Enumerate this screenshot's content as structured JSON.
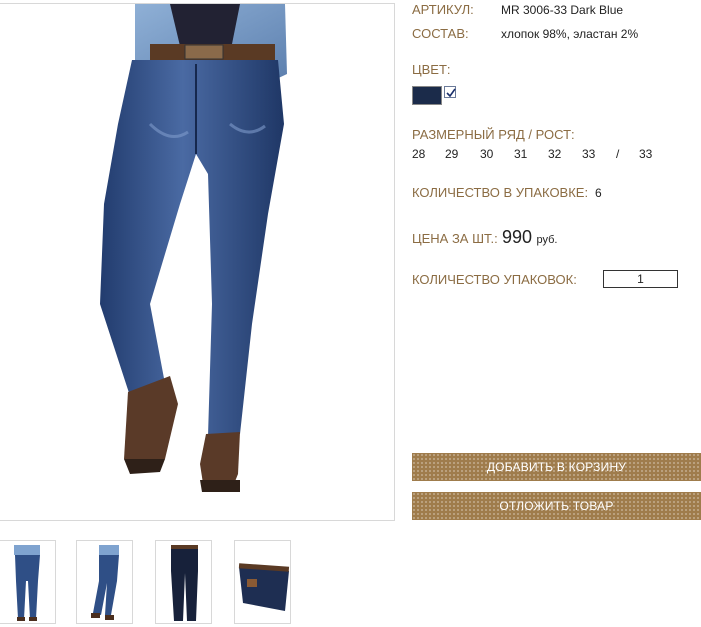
{
  "product": {
    "article_label": "АРТИКУЛ:",
    "article_value": "MR 3006-33 Dark Blue",
    "composition_label": "СОСТАВ:",
    "composition_value": "хлопок 98%, эластан 2%",
    "color_label": "ЦВЕТ:",
    "color_swatch": "#1b2b4a",
    "color_selected": true,
    "size_label": "РАЗМЕРНЫЙ РЯД / РОСТ:",
    "sizes": [
      "28",
      "29",
      "30",
      "31",
      "32",
      "33",
      "/",
      "33"
    ],
    "pack_qty_label": "КОЛИЧЕСТВО В УПАКОВКЕ:",
    "pack_qty_value": "6",
    "price_label": "ЦЕНА ЗА ШТ.:",
    "price_value": "990",
    "price_currency": "руб.",
    "packs_label": "КОЛИЧЕСТВО УПАКОВОК:",
    "packs_value": "1"
  },
  "actions": {
    "add_to_cart": "ДОБАВИТЬ В КОРЗИНУ",
    "save_item": "ОТЛОЖИТЬ ТОВАР"
  },
  "colors": {
    "label": "#8b6c43",
    "button": "#9f7c4c",
    "denim": "#2f4f86"
  },
  "thumbnails": [
    "front-view",
    "side-view",
    "flat-lay",
    "detail-waist"
  ]
}
